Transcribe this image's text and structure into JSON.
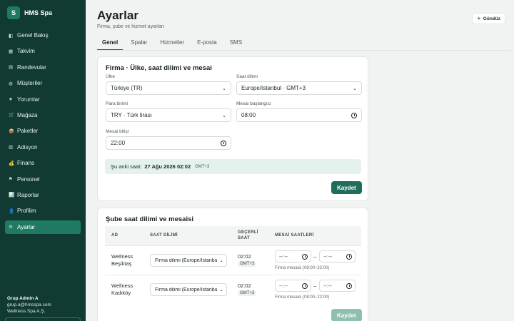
{
  "brand": {
    "logo": "S",
    "name": "HMS Spa"
  },
  "nav": [
    {
      "icon": "◧",
      "label": "Genel Bakış",
      "icon_name": "overview-icon",
      "active": false
    },
    {
      "icon": "▦",
      "label": "Takvim",
      "icon_name": "calendar-icon",
      "active": false
    },
    {
      "icon": "▤",
      "label": "Randevular",
      "icon_name": "appointments-icon",
      "active": false
    },
    {
      "icon": "◍",
      "label": "Müşteriler",
      "icon_name": "customers-icon",
      "active": false
    },
    {
      "icon": "★",
      "label": "Yorumlar",
      "icon_name": "star-icon",
      "active": false
    },
    {
      "icon": "🛒",
      "label": "Mağaza",
      "icon_name": "cart-icon",
      "active": false
    },
    {
      "icon": "📦",
      "label": "Paketler",
      "icon_name": "package-icon",
      "active": false
    },
    {
      "icon": "▥",
      "label": "Adisyon",
      "icon_name": "receipt-icon",
      "active": false
    },
    {
      "icon": "💰",
      "label": "Finans",
      "icon_name": "money-icon",
      "active": false
    },
    {
      "icon": "⚑",
      "label": "Personel",
      "icon_name": "staff-icon",
      "active": false
    },
    {
      "icon": "📊",
      "label": "Raporlar",
      "icon_name": "chart-icon",
      "active": false
    },
    {
      "icon": "👤",
      "label": "Profilim",
      "icon_name": "profile-icon",
      "active": false
    },
    {
      "icon": "⚙",
      "label": "Ayarlar",
      "icon_name": "gear-icon",
      "active": true
    }
  ],
  "user": {
    "name": "Grup Admin A",
    "email": "grup.a@hmsspa.com",
    "company": "Wellness Spa A.Ş."
  },
  "header": {
    "title": "Ayarlar",
    "subtitle": "Firma, şube ve hizmet ayarları",
    "theme_icon": "☀",
    "theme_label": "Gündüz"
  },
  "tabs": [
    "Genel",
    "Spalar",
    "Hizmetler",
    "E-posta",
    "SMS"
  ],
  "firm": {
    "title": "Firma · Ülke, saat dilimi ve mesai",
    "country_label": "Ülke",
    "country_value": "Türkiye (TR)",
    "tz_label": "Saat dilimi",
    "tz_value": "Europe/Istanbul · GMT+3",
    "currency_label": "Para birimi",
    "currency_value": "TRY · Türk lirası",
    "start_label": "Mesai başlangıcı",
    "start_value": "08:00",
    "end_label": "Mesai bitişi",
    "end_value": "22:00",
    "now_label": "Şu anki saat:",
    "now_value": "27 Ağu 2026 02:02",
    "now_tz": "GMT+3",
    "save_label": "Kaydet"
  },
  "branch": {
    "title": "Şube saat dilimi ve mesaisi",
    "columns": [
      "AD",
      "SAAT DİLİMİ",
      "GEÇERLİ\nSAAT",
      "MESAİ SAATLERİ"
    ],
    "rows": [
      {
        "name": "Wellness Beşiktaş",
        "tz": "Firma dilimi (Europe/Istanbul)",
        "time": "02:02",
        "tz_short": "GMT+3",
        "from": "--:--",
        "to": "--:--",
        "hint": "Firma mesaisi (08:00–22:00)"
      },
      {
        "name": "Wellness Kadıköy",
        "tz": "Firma dilimi (Europe/Istanbul)",
        "time": "02:02",
        "tz_short": "GMT+3",
        "from": "--:--",
        "to": "--:--",
        "hint": "Firma mesaisi (08:00–22:00)"
      }
    ],
    "dash": "–",
    "save_label": "Kaydet"
  }
}
